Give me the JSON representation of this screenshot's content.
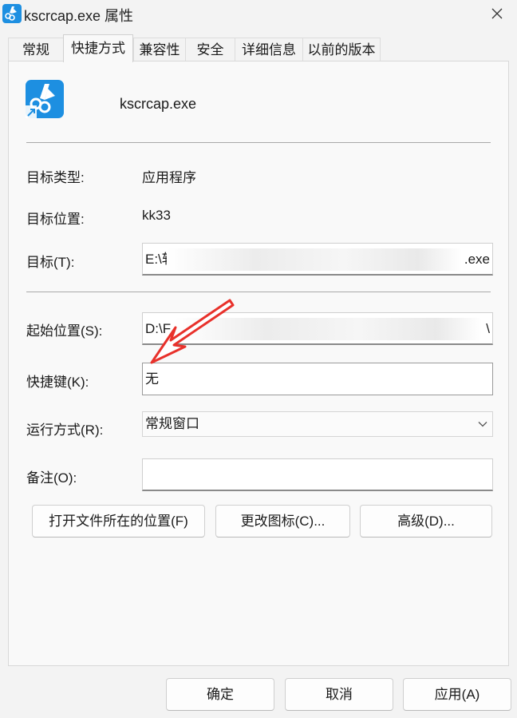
{
  "window": {
    "title": "kscrcap.exe 属性"
  },
  "tabs": [
    {
      "label": "常规"
    },
    {
      "label": "快捷方式"
    },
    {
      "label": "兼容性"
    },
    {
      "label": "安全"
    },
    {
      "label": "详细信息"
    },
    {
      "label": "以前的版本"
    }
  ],
  "active_tab": "快捷方式",
  "app": {
    "name": "kscrcap.exe",
    "icon": "scissors-capture-icon",
    "accent": "#1d8fe1"
  },
  "fields": {
    "target_type_label": "目标类型:",
    "target_type_value": "应用程序",
    "target_location_label": "目标位置:",
    "target_location_value": "kk33",
    "target_label": "目标(T):",
    "target_value_start": "E:\\软",
    "target_value_end": ".exe",
    "start_in_label": "起始位置(S):",
    "start_in_value_start": "D:\\F",
    "start_in_value_end": "\\",
    "shortcut_key_label": "快捷键(K):",
    "shortcut_key_value": "无",
    "run_label": "运行方式(R):",
    "run_value": "常规窗口",
    "comment_label": "备注(O):",
    "comment_value": ""
  },
  "action_buttons": {
    "open_location": "打开文件所在的位置(F)",
    "change_icon": "更改图标(C)...",
    "advanced": "高级(D)..."
  },
  "footer_buttons": {
    "ok": "确定",
    "cancel": "取消",
    "apply": "应用(A)"
  },
  "annotation": {
    "arrow_color": "#e8312b"
  }
}
